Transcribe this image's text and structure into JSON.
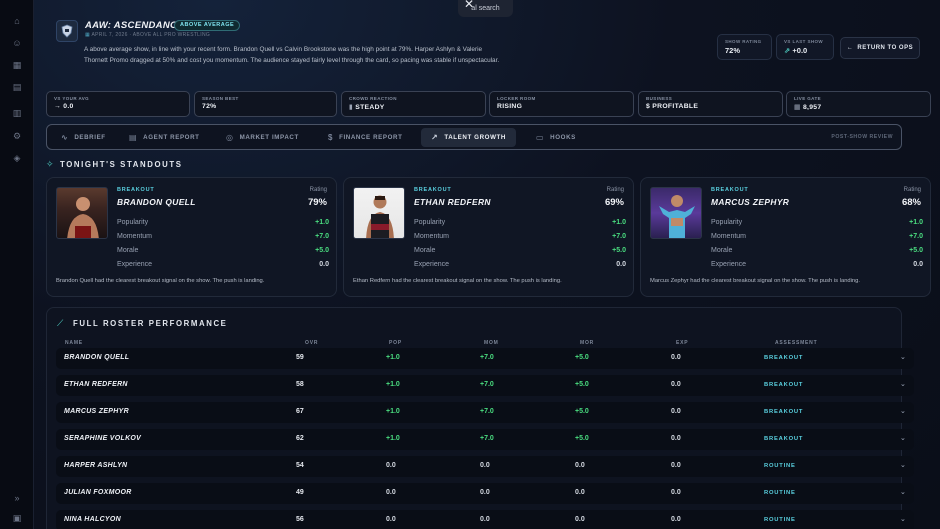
{
  "search": {
    "label": "al search"
  },
  "show": {
    "title": "AAW: ASCENDANCY",
    "badge": "ABOVE AVERAGE",
    "meta": "APRIL 7, 2026  ·  ABOVE ALL PRO WRESTLING",
    "summary": "A above average show, in line with your recent form. Brandon Quell vs Calvin Brookstone was the high point at 79%. Harper Ashlyn & Valerie Thornett Promo dragged at 50% and cost you momentum. The audience stayed fairly level through the card, so pacing was stable if unspectacular."
  },
  "header_stats": {
    "show_rating_label": "SHOW RATING",
    "show_rating": "72%",
    "vs_last_label": "VS LAST SHOW",
    "vs_last": "+0.0",
    "return_label": "RETURN TO OPS"
  },
  "metrics": [
    {
      "label": "VS YOUR AVG",
      "value": "→ 0.0"
    },
    {
      "label": "SEASON BEST",
      "value": "72%"
    },
    {
      "label": "CROWD REACTION",
      "value": "STEADY"
    },
    {
      "label": "LOCKER ROOM",
      "value": "RISING"
    },
    {
      "label": "BUSINESS",
      "value": "PROFITABLE"
    },
    {
      "label": "LIVE GATE",
      "value": "8,957"
    }
  ],
  "tabs": [
    {
      "label": "DEBRIEF",
      "icon": "pulse-icon"
    },
    {
      "label": "AGENT REPORT",
      "icon": "document-icon"
    },
    {
      "label": "MARKET IMPACT",
      "icon": "globe-icon"
    },
    {
      "label": "FINANCE REPORT",
      "icon": "dollar-icon"
    },
    {
      "label": "TALENT GROWTH",
      "icon": "arrow-up-right-icon"
    },
    {
      "label": "HOOKS",
      "icon": "chat-icon"
    }
  ],
  "active_tab": "TALENT GROWTH",
  "post_review": "POST-SHOW REVIEW",
  "standouts": {
    "title": "TONIGHT'S STANDOUTS",
    "rating_label": "Rating",
    "cards": [
      {
        "tag": "BREAKOUT",
        "name": "BRANDON QUELL",
        "rating": "79%",
        "stats": [
          {
            "k": "Popularity",
            "v": "+1.0"
          },
          {
            "k": "Momentum",
            "v": "+7.0"
          },
          {
            "k": "Morale",
            "v": "+5.0"
          },
          {
            "k": "Experience",
            "v": "0.0"
          }
        ],
        "note": "Brandon Quell had the clearest breakout signal on the show. The push is landing."
      },
      {
        "tag": "BREAKOUT",
        "name": "ETHAN REDFERN",
        "rating": "69%",
        "stats": [
          {
            "k": "Popularity",
            "v": "+1.0"
          },
          {
            "k": "Momentum",
            "v": "+7.0"
          },
          {
            "k": "Morale",
            "v": "+5.0"
          },
          {
            "k": "Experience",
            "v": "0.0"
          }
        ],
        "note": "Ethan Redfern had the clearest breakout signal on the show. The push is landing."
      },
      {
        "tag": "BREAKOUT",
        "name": "MARCUS ZEPHYR",
        "rating": "68%",
        "stats": [
          {
            "k": "Popularity",
            "v": "+1.0"
          },
          {
            "k": "Momentum",
            "v": "+7.0"
          },
          {
            "k": "Morale",
            "v": "+5.0"
          },
          {
            "k": "Experience",
            "v": "0.0"
          }
        ],
        "note": "Marcus Zephyr had the clearest breakout signal on the show. The push is landing."
      }
    ]
  },
  "roster": {
    "title": "FULL ROSTER PERFORMANCE",
    "columns": [
      "NAME",
      "OVR",
      "POP",
      "MOM",
      "MOR",
      "EXP",
      "ASSESSMENT"
    ],
    "rows": [
      {
        "name": "BRANDON QUELL",
        "ovr": "59",
        "pop": "+1.0",
        "mom": "+7.0",
        "mor": "+5.0",
        "exp": "0.0",
        "assess": "BREAKOUT"
      },
      {
        "name": "ETHAN REDFERN",
        "ovr": "58",
        "pop": "+1.0",
        "mom": "+7.0",
        "mor": "+5.0",
        "exp": "0.0",
        "assess": "BREAKOUT"
      },
      {
        "name": "MARCUS ZEPHYR",
        "ovr": "67",
        "pop": "+1.0",
        "mom": "+7.0",
        "mor": "+5.0",
        "exp": "0.0",
        "assess": "BREAKOUT"
      },
      {
        "name": "SERAPHINE VOLKOV",
        "ovr": "62",
        "pop": "+1.0",
        "mom": "+7.0",
        "mor": "+5.0",
        "exp": "0.0",
        "assess": "BREAKOUT"
      },
      {
        "name": "HARPER ASHLYN",
        "ovr": "54",
        "pop": "0.0",
        "mom": "0.0",
        "mor": "0.0",
        "exp": "0.0",
        "assess": "ROUTINE"
      },
      {
        "name": "JULIAN FOXMOOR",
        "ovr": "49",
        "pop": "0.0",
        "mom": "0.0",
        "mor": "0.0",
        "exp": "0.0",
        "assess": "ROUTINE"
      },
      {
        "name": "NINA HALCYON",
        "ovr": "56",
        "pop": "0.0",
        "mom": "0.0",
        "mor": "0.0",
        "exp": "0.0",
        "assess": "ROUTINE"
      }
    ]
  },
  "colors": {
    "accent": "#5ad1e0",
    "positive": "#4ade80",
    "background": "#0b0f1a"
  }
}
